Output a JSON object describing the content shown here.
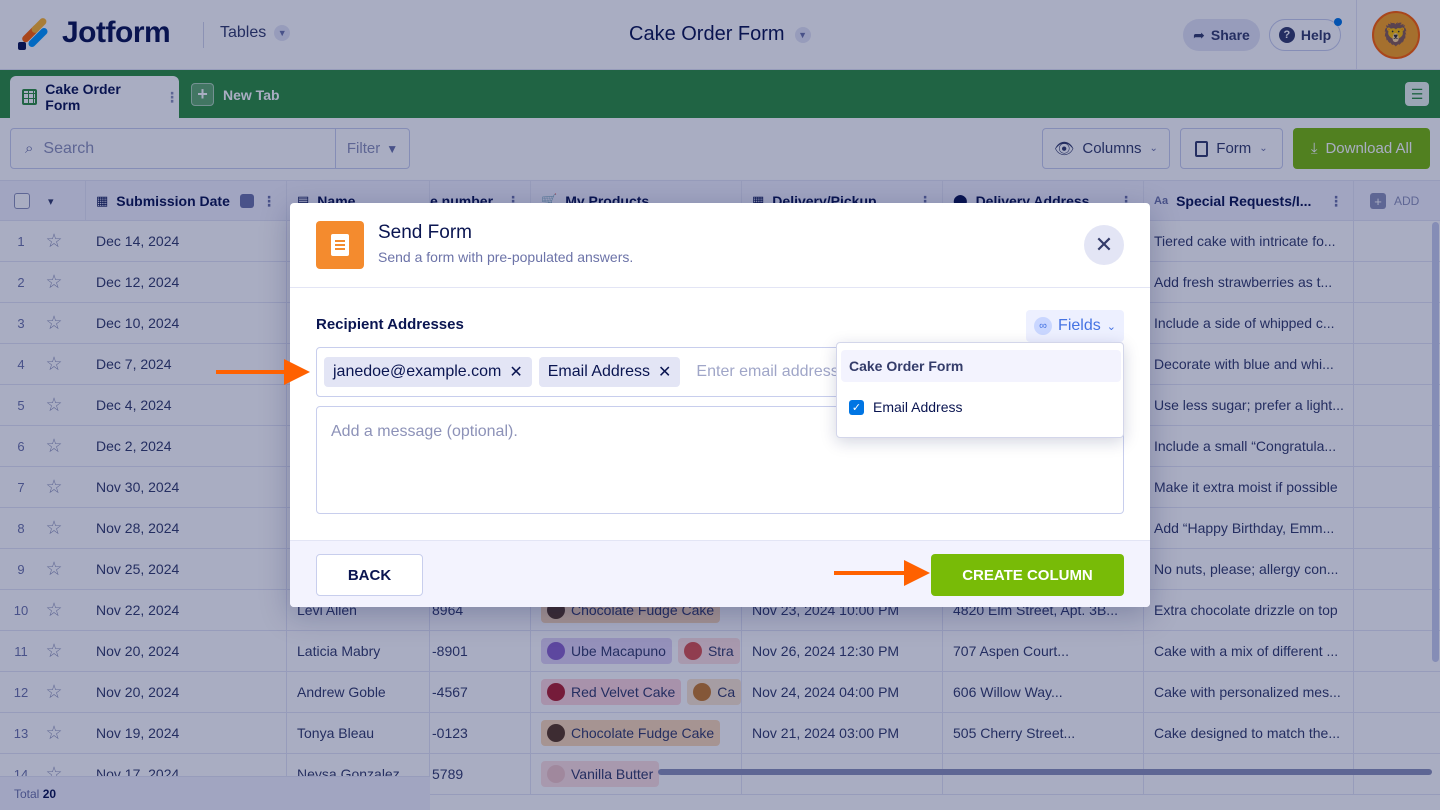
{
  "header": {
    "logo_text": "Jotform",
    "tables_label": "Tables",
    "form_title": "Cake Order Form",
    "share_label": "Share",
    "help_label": "Help"
  },
  "tabs": {
    "active_tab": "Cake Order Form",
    "new_tab": "New Tab"
  },
  "toolbar": {
    "search_placeholder": "Search",
    "filter_label": "Filter",
    "columns_label": "Columns",
    "form_label": "Form",
    "download_label": "Download All"
  },
  "table": {
    "columns": [
      "Submission Date",
      "Name",
      "e number",
      "My Products",
      "Delivery/Pickup",
      "Delivery Address",
      "Special Requests/I..."
    ],
    "add_label": "ADD",
    "rows": [
      {
        "num": "1",
        "date": "Dec 14, 2024",
        "name": "",
        "phone": "",
        "products": [],
        "delivery": "",
        "address": "",
        "requests": "Tiered cake with intricate fo..."
      },
      {
        "num": "2",
        "date": "Dec 12, 2024",
        "name": "",
        "phone": "",
        "products": [],
        "delivery": "",
        "address": "",
        "requests": "Add fresh strawberries as t..."
      },
      {
        "num": "3",
        "date": "Dec 10, 2024",
        "name": "",
        "phone": "",
        "products": [],
        "delivery": "",
        "address": "",
        "requests": "Include a side of whipped c..."
      },
      {
        "num": "4",
        "date": "Dec 7, 2024",
        "name": "",
        "phone": "",
        "products": [],
        "delivery": "",
        "address": "",
        "requests": "Decorate with blue and whi..."
      },
      {
        "num": "5",
        "date": "Dec 4, 2024",
        "name": "",
        "phone": "",
        "products": [],
        "delivery": "",
        "address": "",
        "requests": "Use less sugar; prefer a light..."
      },
      {
        "num": "6",
        "date": "Dec 2, 2024",
        "name": "",
        "phone": "",
        "products": [],
        "delivery": "",
        "address": "",
        "requests": "Include a small “Congratula..."
      },
      {
        "num": "7",
        "date": "Nov 30, 2024",
        "name": "",
        "phone": "",
        "products": [],
        "delivery": "",
        "address": "",
        "requests": "Make it extra moist if possible"
      },
      {
        "num": "8",
        "date": "Nov 28, 2024",
        "name": "",
        "phone": "",
        "products": [],
        "delivery": "",
        "address": "",
        "requests": "Add “Happy Birthday, Emm..."
      },
      {
        "num": "9",
        "date": "Nov 25, 2024",
        "name": "",
        "phone": "",
        "products": [],
        "delivery": "",
        "address": "",
        "requests": "No nuts, please; allergy con..."
      },
      {
        "num": "10",
        "date": "Nov 22, 2024",
        "name": "Levi Allen",
        "phone": "8964",
        "products": [
          {
            "label": "Chocolate Fudge Cake",
            "bg": "#fbd9b6",
            "dot": "#5a3a22"
          }
        ],
        "delivery": "Nov 23, 2024 10:00 PM",
        "address": "4820 Elm Street, Apt. 3B...",
        "requests": "Extra chocolate drizzle on top"
      },
      {
        "num": "11",
        "date": "Nov 20, 2024",
        "name": "Laticia Mabry",
        "phone": "-8901",
        "products": [
          {
            "label": "Ube Macapuno",
            "bg": "#e1d4f5",
            "dot": "#8a63c9"
          },
          {
            "label": "Stra",
            "bg": "#fde1e1",
            "dot": "#d9534f"
          }
        ],
        "delivery": "Nov 26, 2024 12:30 PM",
        "address": "707 Aspen Court...",
        "requests": "Cake with a mix of different ..."
      },
      {
        "num": "12",
        "date": "Nov 20, 2024",
        "name": "Andrew Goble",
        "phone": "-4567",
        "products": [
          {
            "label": "Red Velvet Cake",
            "bg": "#fdd6dc",
            "dot": "#b0202e"
          },
          {
            "label": "Ca",
            "bg": "#fbe6cf",
            "dot": "#c77b2b"
          }
        ],
        "delivery": "Nov 24, 2024 04:00 PM",
        "address": "606 Willow Way...",
        "requests": "Cake with personalized mes..."
      },
      {
        "num": "13",
        "date": "Nov 19, 2024",
        "name": "Tonya Bleau",
        "phone": "-0123",
        "products": [
          {
            "label": "Chocolate Fudge Cake",
            "bg": "#fbd9b6",
            "dot": "#5a3a22"
          }
        ],
        "delivery": "Nov 21, 2024 03:00 PM",
        "address": "505 Cherry Street...",
        "requests": "Cake designed to match the..."
      },
      {
        "num": "14",
        "date": "Nov 17, 2024",
        "name": "Neysa Gonzalez",
        "phone": "5789",
        "products": [
          {
            "label": "Vanilla Butter",
            "bg": "#fde1e1",
            "dot": "#f2c7c7"
          }
        ],
        "delivery": "",
        "address": "",
        "requests": ""
      }
    ],
    "total_label": "Total",
    "total_count": "20"
  },
  "modal": {
    "title": "Send Form",
    "subtitle": "Send a form with pre-populated answers.",
    "recipient_label": "Recipient Addresses",
    "fields_label": "Fields",
    "tags": [
      "janedoe@example.com",
      "Email Address"
    ],
    "recipient_placeholder": "Enter email addresses",
    "message_placeholder": "Add a message (optional).",
    "back_label": "BACK",
    "create_label": "CREATE COLUMN"
  },
  "dropdown": {
    "heading": "Cake Order Form",
    "item_label": "Email Address",
    "item_checked": true
  },
  "colors": {
    "brand_green": "#2d8f3e",
    "action_green": "#78bb07",
    "accent_orange": "#ff6100",
    "navy": "#0a1551",
    "blue": "#0075e3"
  }
}
